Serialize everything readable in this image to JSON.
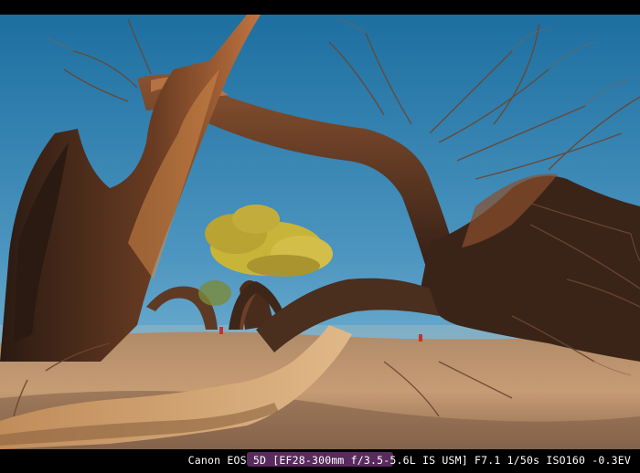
{
  "photo": {
    "subject": "desert-poplar-trees",
    "colors": {
      "sky_top": "#1d6fa0",
      "sky_bottom": "#7fbad8",
      "sand": "#c69c74",
      "sand_shadow": "#5a4234",
      "trunk_dark": "#3a2418",
      "trunk_lit": "#b86a38",
      "canopy": "#c9b43a"
    }
  },
  "caption": {
    "exif_text": "Canon EOS 5D [EF28-300mm f/3.5-5.6L IS USM] F7.1 1/50s ISO160 -0.3EV"
  }
}
